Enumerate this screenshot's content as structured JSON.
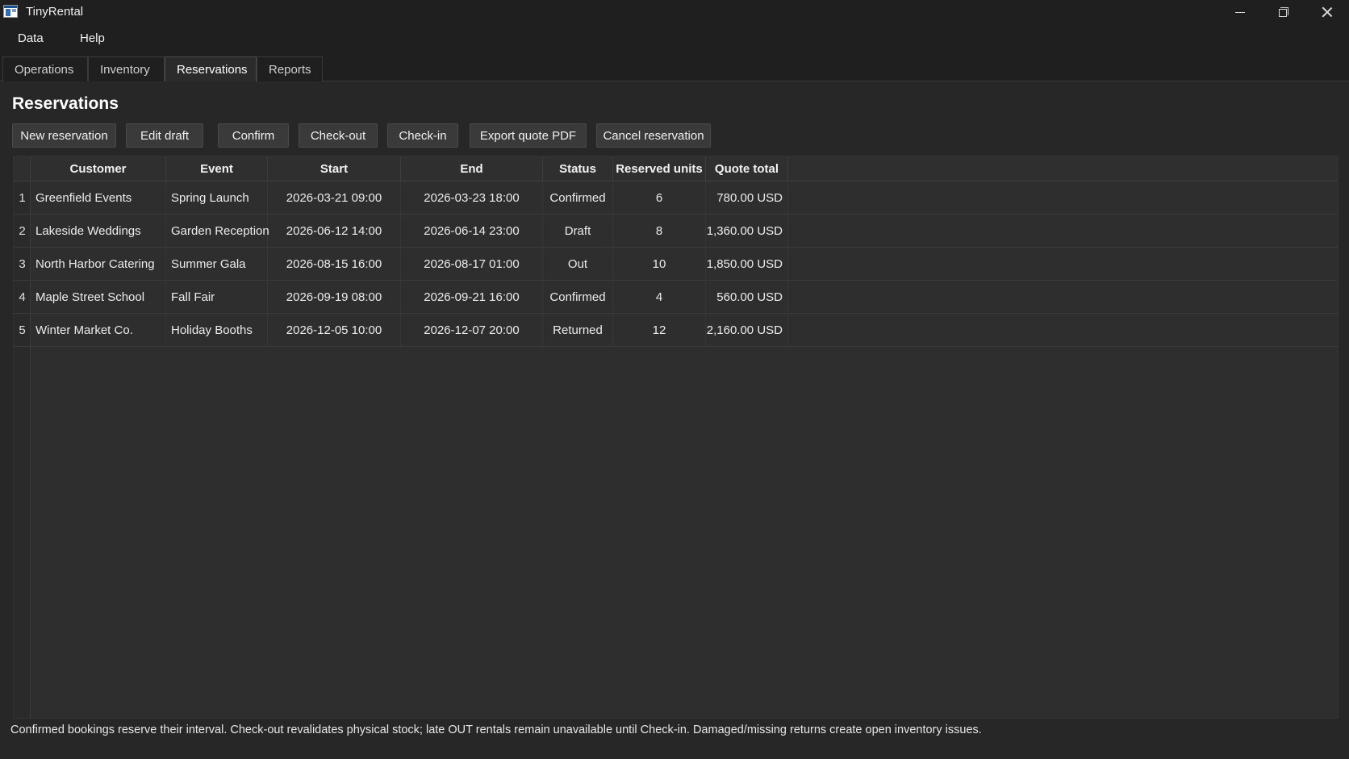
{
  "window": {
    "title": "TinyRental"
  },
  "menu": {
    "items": [
      "Data",
      "Help"
    ]
  },
  "tabs": {
    "items": [
      "Operations",
      "Inventory",
      "Reservations",
      "Reports"
    ],
    "active": "Reservations"
  },
  "page": {
    "title": "Reservations"
  },
  "toolbar": {
    "buttons": [
      "New reservation",
      "Edit draft",
      "Confirm",
      "Check-out",
      "Check-in",
      "Export quote PDF",
      "Cancel reservation"
    ]
  },
  "table": {
    "columns": [
      "Customer",
      "Event",
      "Start",
      "End",
      "Status",
      "Reserved units",
      "Quote total"
    ],
    "rows": [
      {
        "num": "1",
        "customer": "Greenfield Events",
        "event": "Spring Launch",
        "start": "2026-03-21  09:00",
        "end": "2026-03-23  18:00",
        "status": "Confirmed",
        "units": "6",
        "total": "780.00  USD"
      },
      {
        "num": "2",
        "customer": "Lakeside Weddings",
        "event": "Garden Reception",
        "start": "2026-06-12  14:00",
        "end": "2026-06-14  23:00",
        "status": "Draft",
        "units": "8",
        "total": "1,360.00  USD"
      },
      {
        "num": "3",
        "customer": "North Harbor Catering",
        "event": "Summer Gala",
        "start": "2026-08-15  16:00",
        "end": "2026-08-17  01:00",
        "status": "Out",
        "units": "10",
        "total": "1,850.00  USD"
      },
      {
        "num": "4",
        "customer": "Maple Street School",
        "event": "Fall Fair",
        "start": "2026-09-19  08:00",
        "end": "2026-09-21  16:00",
        "status": "Confirmed",
        "units": "4",
        "total": "560.00  USD"
      },
      {
        "num": "5",
        "customer": "Winter Market Co.",
        "event": "Holiday Booths",
        "start": "2026-12-05  10:00",
        "end": "2026-12-07  20:00",
        "status": "Returned",
        "units": "12",
        "total": "2,160.00  USD"
      }
    ]
  },
  "footer": {
    "note": "Confirmed bookings reserve their interval. Check-out revalidates physical stock; late OUT rentals remain unavailable until Check-in. Damaged/missing returns create open inventory issues."
  },
  "icons": {
    "app": "app-window-icon",
    "minimize": "minimize-icon",
    "maximize": "restore-icon",
    "close": "close-icon"
  }
}
